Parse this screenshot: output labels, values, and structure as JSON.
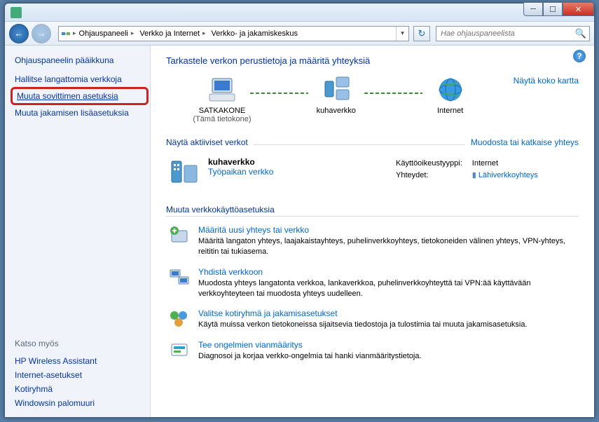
{
  "window": {
    "controls": {
      "min": "─",
      "max": "☐",
      "close": "✕"
    }
  },
  "nav": {
    "back": "←",
    "forward": "→",
    "breadcrumb": [
      "Ohjauspaneeli",
      "Verkko ja Internet",
      "Verkko- ja jakamiskeskus"
    ],
    "refresh": "↻"
  },
  "search": {
    "placeholder": "Hae ohjauspaneelista",
    "icon": "🔍"
  },
  "sidebar": {
    "home": "Ohjauspaneelin pääikkuna",
    "links": [
      "Hallitse langattomia verkkoja",
      "Muuta sovittimen asetuksia",
      "Muuta jakamisen lisäasetuksia"
    ],
    "see_also_head": "Katso myös",
    "see_also": [
      "HP Wireless Assistant",
      "Internet-asetukset",
      "Kotiryhmä",
      "Windowsin palomuuri"
    ]
  },
  "main": {
    "title": "Tarkastele verkon perustietoja ja määritä yhteyksiä",
    "map_link": "Näytä koko kartta",
    "map": {
      "node1": "SATKAKONE",
      "node1_sub": "(Tämä tietokone)",
      "node2": "kuhaverkko",
      "node3": "Internet"
    },
    "active_head": "Näytä aktiiviset verkot",
    "active_link": "Muodosta tai katkaise yhteys",
    "network": {
      "name": "kuhaverkko",
      "type": "Työpaikan verkko",
      "access_label": "Käyttöoikeustyyppi:",
      "access_value": "Internet",
      "conn_label": "Yhteydet:",
      "conn_value": "Lähiverkkoyhteys"
    },
    "settings_head": "Muuta verkkokäyttöasetuksia",
    "tasks": [
      {
        "title": "Määritä uusi yhteys tai verkko",
        "desc": "Määritä langaton yhteys, laajakaistayhteys, puhelinverkkoyhteys, tietokoneiden välinen yhteys, VPN-yhteys, reititin tai tukiasema."
      },
      {
        "title": "Yhdistä verkkoon",
        "desc": "Muodosta yhteys langatonta verkkoa, lankaverkkoa, puhelinverkkoyhteyttä tai VPN:ää käyttävään verkkoyhteyteen tai muodosta yhteys uudelleen."
      },
      {
        "title": "Valitse kotiryhmä ja jakamisasetukset",
        "desc": "Käytä muissa verkon tietokoneissa sijaitsevia tiedostoja ja tulostimia tai muuta jakamisasetuksia."
      },
      {
        "title": "Tee ongelmien vianmääritys",
        "desc": "Diagnosoi ja korjaa verkko-ongelmia tai hanki vianmääritystietoja."
      }
    ]
  }
}
